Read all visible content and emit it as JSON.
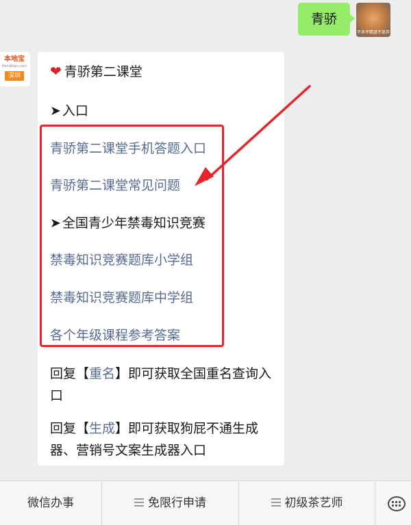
{
  "user_message": {
    "text": "青骄",
    "avatar_caption": "不多不精进不放弃"
  },
  "bot": {
    "avatar": {
      "logo_text": "本地宝",
      "logo_url": "Bendibao.com",
      "city": "深圳"
    },
    "card": {
      "title": "青骄第二课堂",
      "heart_icon": "heart-icon",
      "section1_label": "入口",
      "link1": "青骄第二课堂手机答题入口",
      "link2": "青骄第二课堂常见问题",
      "section2_label": "全国青少年禁毒知识竞赛",
      "link3": "禁毒知识竞赛题库小学组",
      "link4": "禁毒知识竞赛题库中学组",
      "link5": "各个年级课程参考答案",
      "reply1_prefix": "回复【",
      "reply1_keyword": "重名",
      "reply1_suffix": "】即可获取全国重名查询入口",
      "reply2_prefix": "回复【",
      "reply2_keyword": "生成",
      "reply2_suffix": "】即可获取狗屁不通生成器、营销号文案生成器入口"
    }
  },
  "menu": {
    "item1": "微信办事",
    "item2": "免限行申请",
    "item3": "初级茶艺师"
  },
  "colors": {
    "background": "#ededed",
    "user_bubble": "#95ec69",
    "link": "#576b95",
    "highlight_red": "#e5252a"
  }
}
